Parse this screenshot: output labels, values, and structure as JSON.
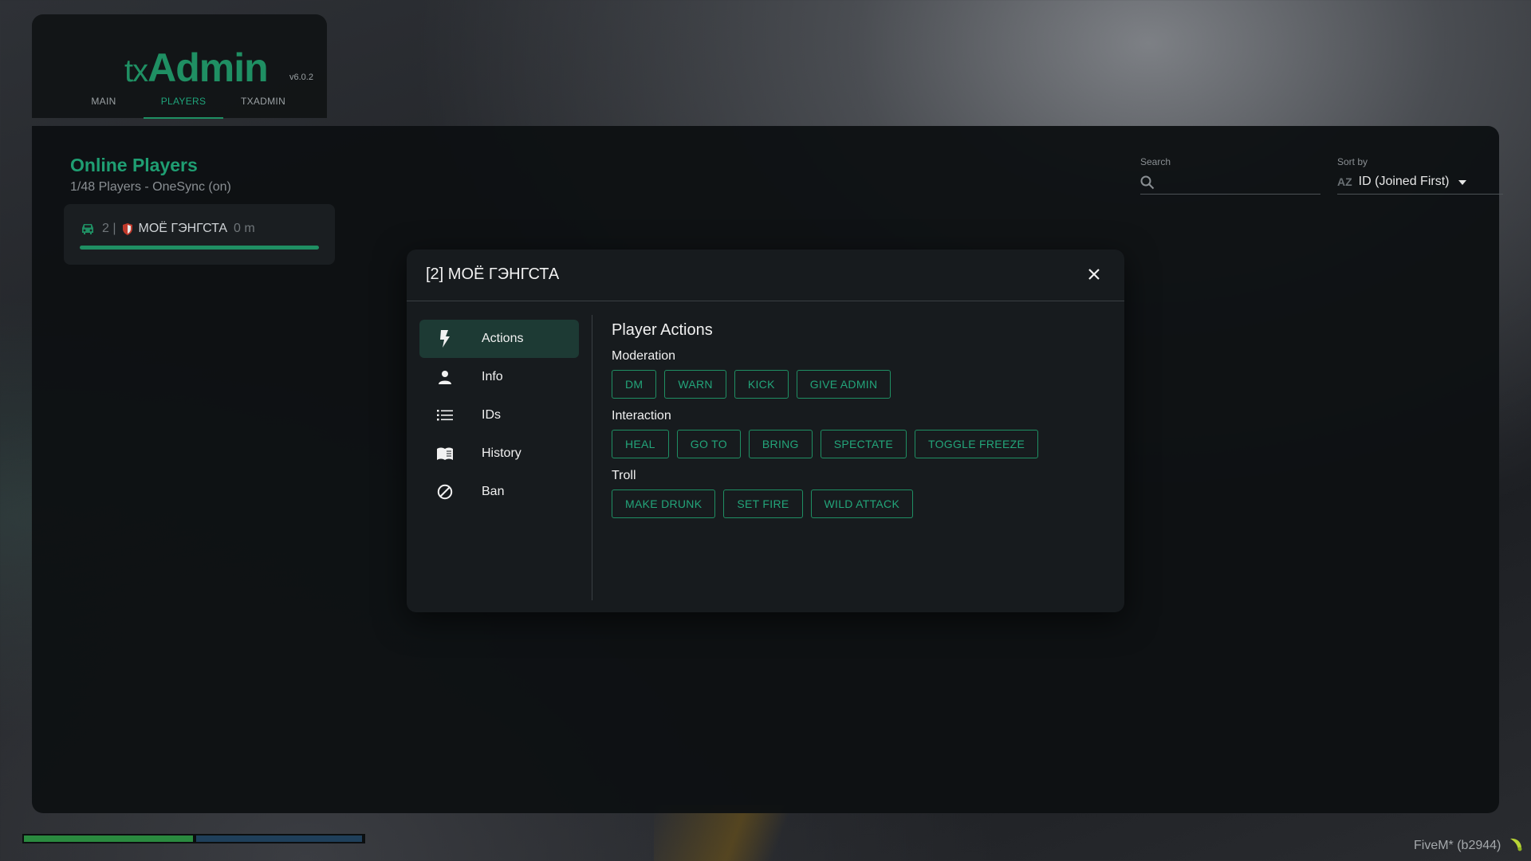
{
  "app": {
    "logo_prefix": "tx",
    "logo_main": "Admin",
    "version": "v6.0.2"
  },
  "nav": {
    "tabs": [
      {
        "label": "MAIN",
        "active": false
      },
      {
        "label": "PLAYERS",
        "active": true
      },
      {
        "label": "TXADMIN",
        "active": false
      }
    ]
  },
  "players_panel": {
    "title": "Online Players",
    "subtitle": "1/48 Players - OneSync (on)",
    "search": {
      "label": "Search",
      "value": "",
      "placeholder": ""
    },
    "sort": {
      "label": "Sort by",
      "value": "ID (Joined First)",
      "icon": "AZ"
    },
    "players": [
      {
        "id": "2 |",
        "name": "МОЁ ГЭНГСТА",
        "time": "0 m",
        "health_percent": 100,
        "vehicle_icon": "car-icon",
        "status_icon": "shield-icon"
      }
    ]
  },
  "modal": {
    "title": "[2] МОЁ ГЭНГСТА",
    "sidebar": [
      {
        "label": "Actions",
        "icon": "lightning-icon",
        "active": true
      },
      {
        "label": "Info",
        "icon": "person-icon",
        "active": false
      },
      {
        "label": "IDs",
        "icon": "list-icon",
        "active": false
      },
      {
        "label": "History",
        "icon": "book-icon",
        "active": false
      },
      {
        "label": "Ban",
        "icon": "ban-icon",
        "active": false
      }
    ],
    "actions_title": "Player Actions",
    "sections": [
      {
        "title": "Moderation",
        "buttons": [
          "DM",
          "WARN",
          "KICK",
          "GIVE ADMIN"
        ]
      },
      {
        "title": "Interaction",
        "buttons": [
          "HEAL",
          "GO TO",
          "BRING",
          "SPECTATE",
          "TOGGLE FREEZE"
        ]
      },
      {
        "title": "Troll",
        "buttons": [
          "MAKE DRUNK",
          "SET FIRE",
          "WILD ATTACK"
        ]
      }
    ]
  },
  "footer": {
    "client_label": "FiveM* (b2944)"
  },
  "colors": {
    "accent": "#1f8f63",
    "panel_bg": "#0e1113",
    "modal_bg": "#171b1e",
    "active_item_bg": "#1d3a34"
  }
}
